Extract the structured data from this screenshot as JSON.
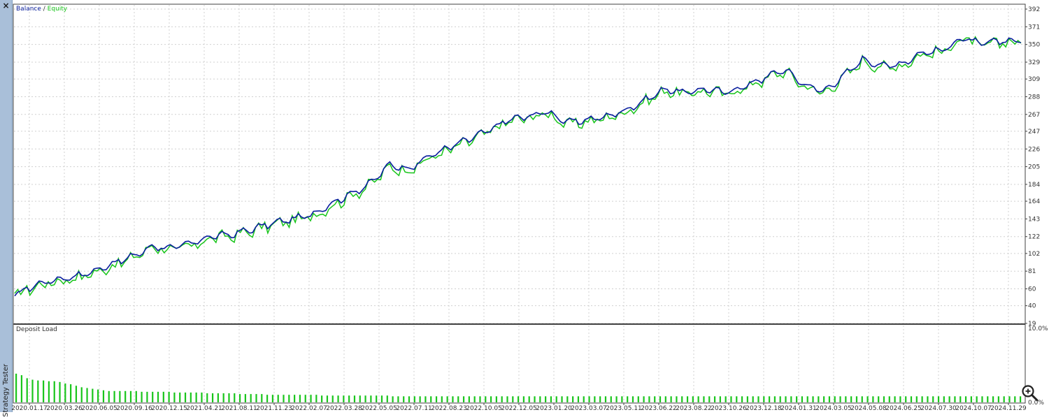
{
  "sidebar": {
    "close_label": "×",
    "title": "Strategy Tester"
  },
  "legend": {
    "balance": "Balance",
    "separator": " / ",
    "equity": "Equity"
  },
  "deposit_label": "Deposit Load",
  "colors": {
    "balance": "#0a1f9e",
    "equity": "#19c51b",
    "deposit_bar": "#19c51b",
    "grid": "#d0d0d0"
  },
  "icons": {
    "zoom": "magnifier-plus-icon",
    "close": "close-icon"
  },
  "chart_data": [
    {
      "type": "line",
      "title": "",
      "y_ticks": [
        19,
        40,
        60,
        81,
        102,
        122,
        143,
        164,
        184,
        205,
        226,
        247,
        267,
        288,
        309,
        329,
        350,
        371,
        392
      ],
      "ylim": [
        19,
        392
      ],
      "x_tick_labels": [
        "2020.01.17",
        "2020.03.26",
        "2020.06.05",
        "2020.09.16",
        "2020.12.15",
        "2021.04.21",
        "2021.08.11",
        "2021.11.23",
        "2022.02.07",
        "2022.03.28",
        "2022.05.05",
        "2022.07.11",
        "2022.08.23",
        "2022.10.05",
        "2022.12.05",
        "2023.01.20",
        "2023.03.07",
        "2023.05.11",
        "2023.06.22",
        "2023.08.22",
        "2023.10.26",
        "2023.12.18",
        "2024.01.31",
        "2024.03.05",
        "2024.05.08",
        "2024.06.25",
        "2024.07.30",
        "2024.10.07",
        "2024.11.29"
      ],
      "grid": true,
      "legend_position": "top-left",
      "series": [
        {
          "name": "Balance",
          "values": [
            50,
            62,
            68,
            72,
            78,
            88,
            96,
            108,
            106,
            112,
            120,
            122,
            128,
            135,
            140,
            145,
            158,
            170,
            182,
            205,
            200,
            215,
            225,
            235,
            245,
            258,
            262,
            268,
            255,
            258,
            262,
            270,
            282,
            295,
            290,
            295,
            290,
            298,
            308,
            318,
            300,
            292,
            310,
            330,
            322,
            325,
            338,
            340,
            355,
            348,
            352,
            352
          ]
        },
        {
          "name": "Equity",
          "values": [
            50,
            60,
            66,
            70,
            76,
            85,
            94,
            108,
            103,
            108,
            118,
            120,
            126,
            133,
            138,
            143,
            155,
            168,
            180,
            202,
            198,
            212,
            222,
            232,
            243,
            256,
            260,
            266,
            252,
            256,
            260,
            268,
            280,
            293,
            288,
            293,
            288,
            296,
            306,
            316,
            298,
            290,
            308,
            328,
            320,
            323,
            336,
            338,
            355,
            345,
            350,
            351
          ]
        }
      ]
    },
    {
      "type": "bar",
      "title": "Deposit Load",
      "y_ticks": [
        "10.0%",
        "0.0%"
      ],
      "ylim": [
        0,
        10
      ],
      "unit": "%",
      "series": [
        {
          "name": "Deposit Load",
          "values": [
            3.8,
            3.6,
            3.2,
            3.0,
            2.9,
            2.9,
            2.8,
            2.8,
            2.7,
            2.5,
            2.4,
            2.2,
            2.0,
            1.9,
            1.8,
            1.7,
            1.6,
            1.5,
            1.5,
            1.5,
            1.5,
            1.5,
            1.5,
            1.4,
            1.4,
            1.4,
            1.4,
            1.4,
            1.4,
            1.3,
            1.3,
            1.3,
            1.3,
            1.3,
            1.3,
            1.2,
            1.2,
            1.2,
            1.2,
            1.2,
            1.2,
            1.1,
            1.1,
            1.1,
            1.1,
            1.1,
            1.0,
            1.0,
            1.0,
            1.0,
            1.0,
            1.0,
            1.0,
            1.0,
            1.0,
            1.0,
            0.9,
            0.9,
            0.9,
            0.9,
            0.9,
            0.9,
            0.9,
            0.9,
            0.9,
            0.9,
            0.9,
            0.9,
            0.9,
            0.8,
            0.8,
            0.8,
            0.8,
            0.8,
            0.8,
            0.8,
            0.8,
            0.8,
            0.8,
            0.8,
            0.8,
            0.8,
            0.8,
            0.8,
            0.8,
            0.8,
            0.8,
            0.8,
            0.8,
            0.8,
            0.8,
            0.8,
            0.8,
            0.8,
            0.8,
            0.8,
            0.8,
            0.8,
            0.8,
            0.8,
            0.8,
            0.8,
            0.8,
            0.8,
            0.8,
            0.8,
            0.8,
            0.8,
            0.8,
            0.8,
            0.8,
            0.8,
            0.8,
            0.8,
            0.8,
            0.8,
            0.8,
            0.8,
            0.8,
            0.8,
            0.8,
            0.8,
            0.8,
            0.8,
            0.8,
            0.8,
            0.8,
            0.8,
            0.8,
            0.8,
            0.8,
            0.8,
            0.8,
            0.8,
            0.8,
            0.8,
            0.8,
            0.8,
            0.8,
            0.8,
            0.8,
            0.8,
            0.8,
            0.8,
            0.8,
            0.8,
            0.8,
            0.8,
            0.8,
            0.8,
            0.8,
            0.8,
            0.8,
            0.8,
            0.8,
            0.8,
            0.8,
            0.8,
            0.8,
            0.8,
            0.8,
            0.8,
            0.8,
            0.8,
            0.8,
            0.8,
            0.8,
            0.8,
            0.8,
            0.8,
            0.8,
            0.8,
            0.8,
            0.8,
            0.8,
            0.8,
            0.8,
            0.8,
            0.8,
            0.8,
            0.8,
            0.8,
            0.8,
            0.8,
            0.8
          ]
        }
      ]
    }
  ]
}
